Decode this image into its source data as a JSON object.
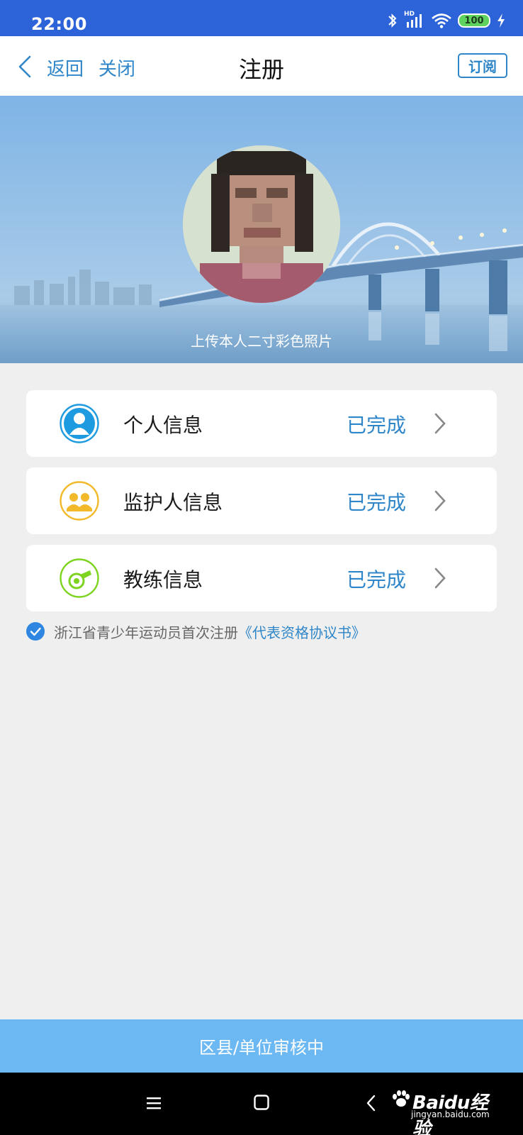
{
  "status_bar": {
    "time": "22:00",
    "network_label": "HD",
    "battery_level": "100"
  },
  "nav": {
    "back_label": "返回",
    "close_label": "关闭",
    "title": "注册",
    "subscribe_label": "订阅"
  },
  "banner": {
    "upload_caption": "上传本人二寸彩色照片"
  },
  "cards": [
    {
      "label": "个人信息",
      "status": "已完成",
      "icon": "person-icon",
      "icon_color": "#1e9be0"
    },
    {
      "label": "监护人信息",
      "status": "已完成",
      "icon": "guardian-icon",
      "icon_color": "#f2b92b"
    },
    {
      "label": "教练信息",
      "status": "已完成",
      "icon": "whistle-icon",
      "icon_color": "#7ed321"
    }
  ],
  "agreement": {
    "checked": true,
    "text": "浙江省青少年运动员首次注册",
    "link_text": "《代表资格协议书》"
  },
  "review_status": "区县/单位审核中",
  "watermark": {
    "brand": "Baidu经验",
    "site": "jingyan.baidu.com"
  },
  "colors": {
    "status_bar": "#2d63d8",
    "accent": "#2f86c8",
    "review_bar": "#6cb8f2",
    "page_background": "#efefef"
  }
}
